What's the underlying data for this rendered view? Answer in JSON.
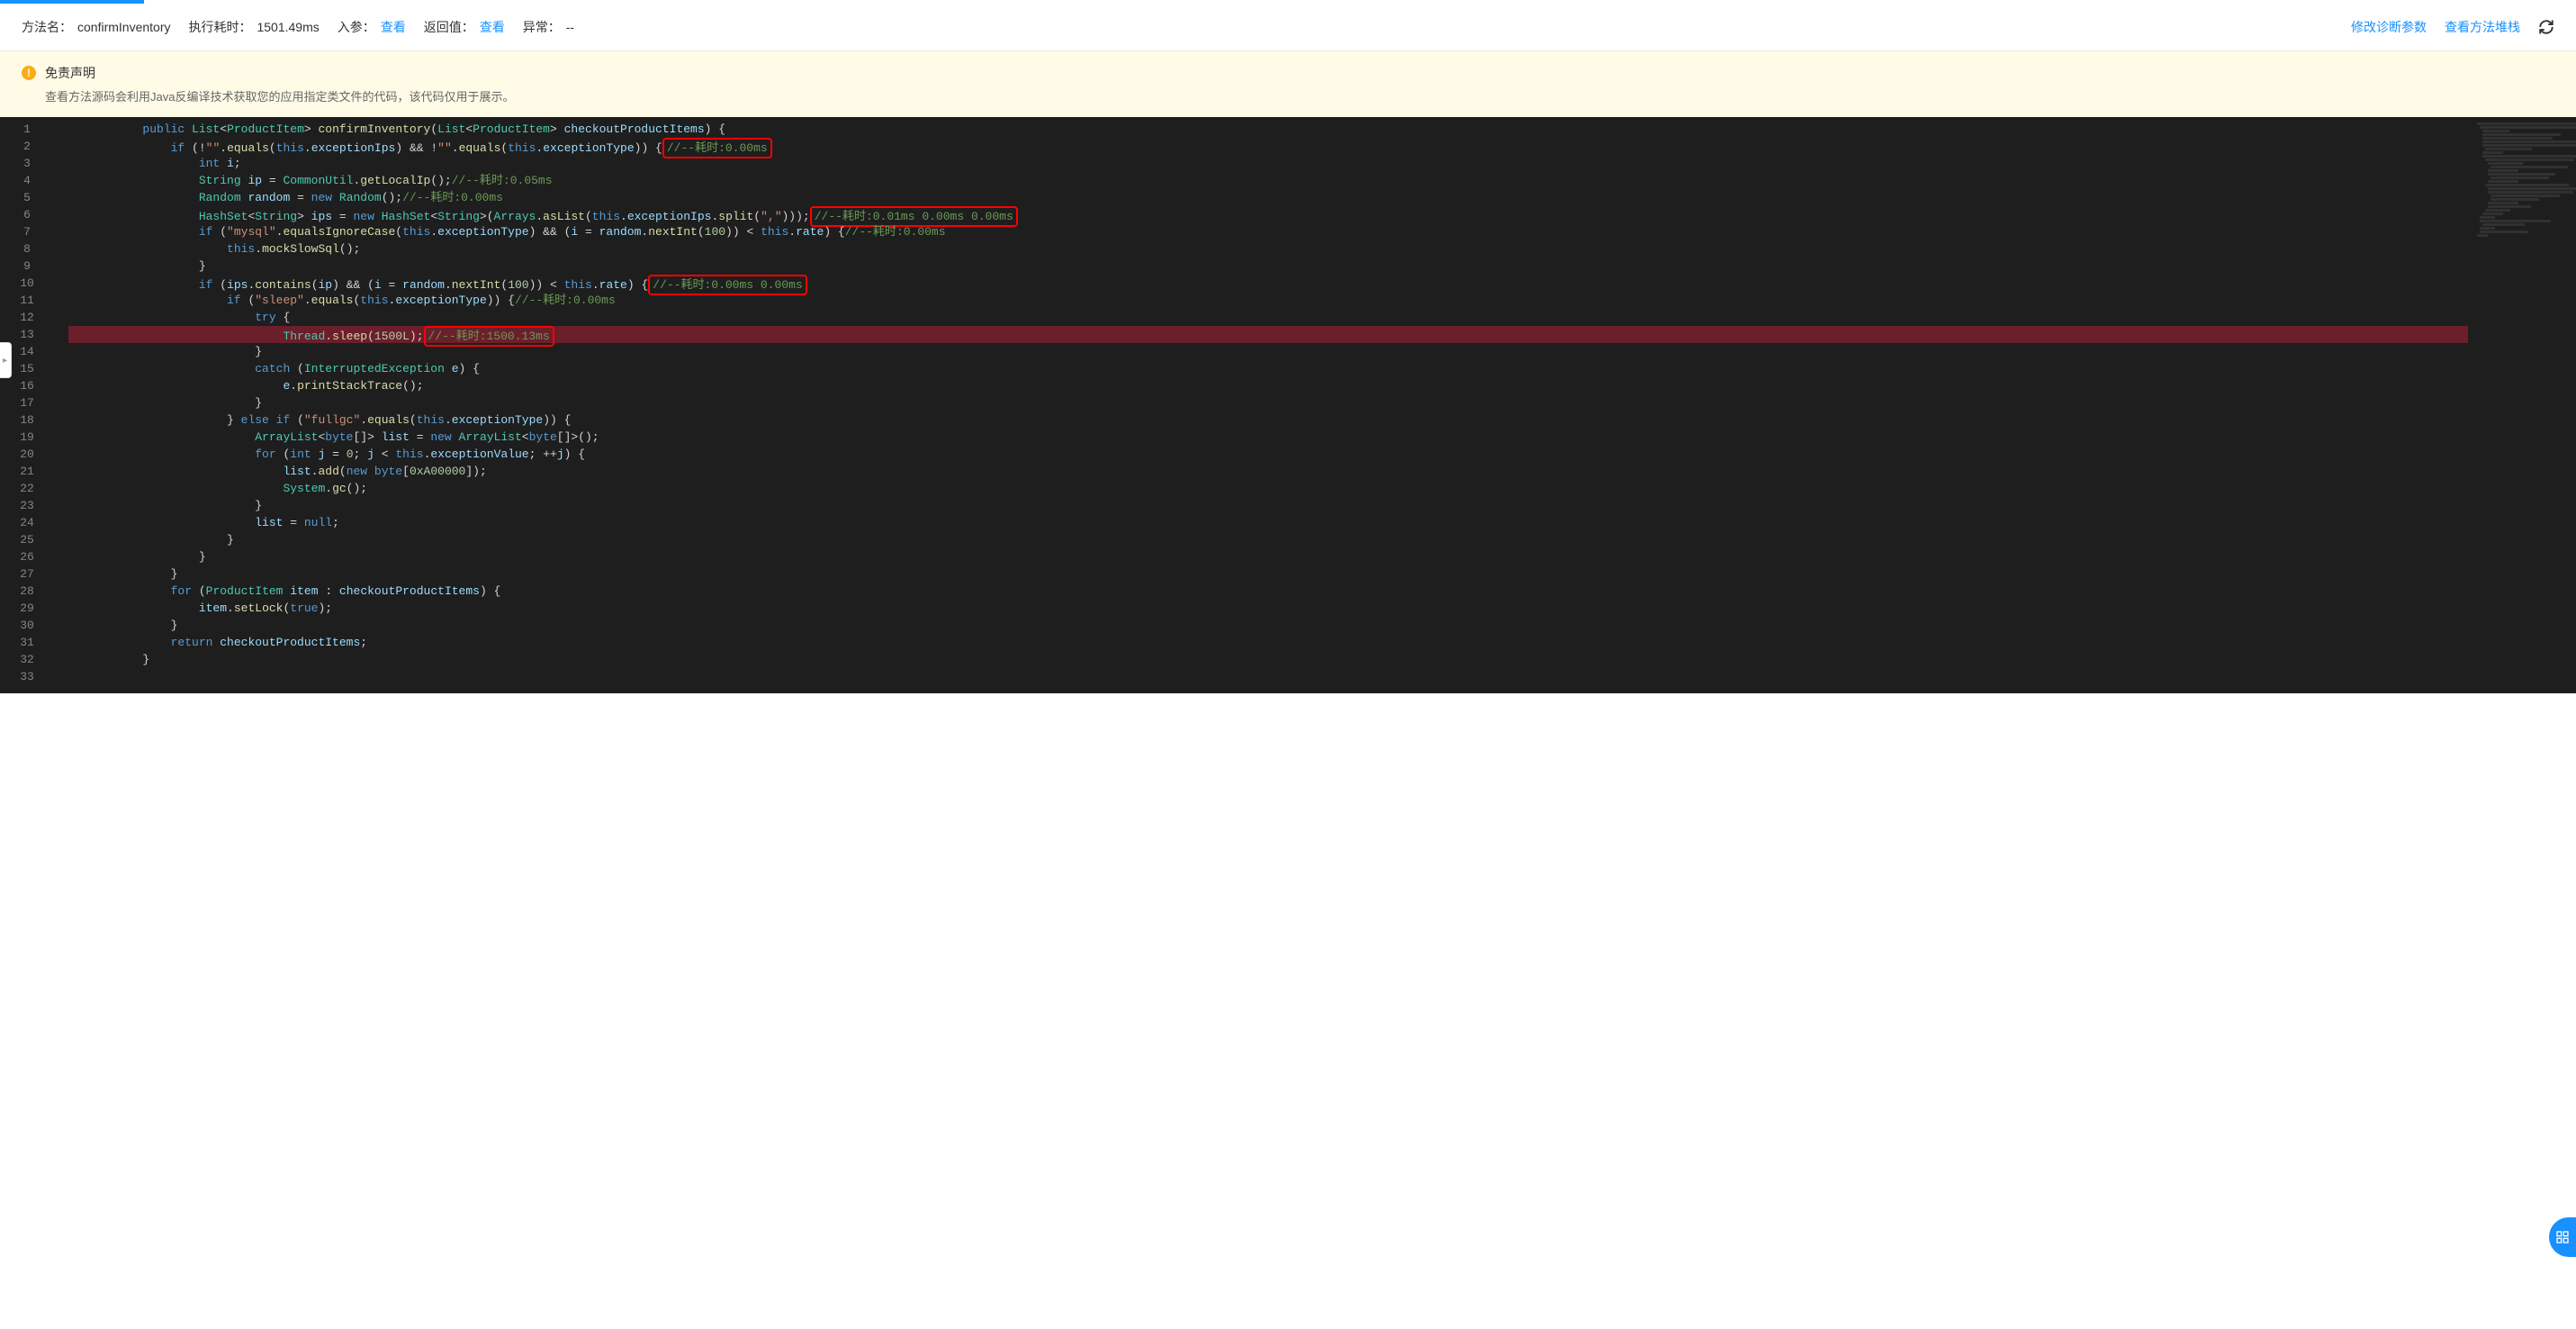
{
  "header": {
    "method_name_label": "方法名：",
    "method_name": "confirmInventory",
    "exec_time_label": "执行耗时：",
    "exec_time": "1501.49ms",
    "in_params_label": "入参：",
    "in_params_link": "查看",
    "return_value_label": "返回值：",
    "return_value_link": "查看",
    "exception_label": "异常：",
    "exception_value": "--",
    "modify_diag_params": "修改诊断参数",
    "view_method_stack": "查看方法堆栈"
  },
  "disclaimer": {
    "icon": "!",
    "title": "免责声明",
    "text": "查看方法源码会利用Java反编译技术获取您的应用指定类文件的代码，该代码仅用于展示。"
  },
  "code": {
    "lines": [
      {
        "n": 1,
        "indent": 2,
        "segs": [
          {
            "t": "public ",
            "c": "kw"
          },
          {
            "t": "List",
            "c": "type"
          },
          {
            "t": "<"
          },
          {
            "t": "ProductItem",
            "c": "type"
          },
          {
            "t": "> "
          },
          {
            "t": "confirmInventory",
            "c": "fn"
          },
          {
            "t": "("
          },
          {
            "t": "List",
            "c": "type"
          },
          {
            "t": "<"
          },
          {
            "t": "ProductItem",
            "c": "type"
          },
          {
            "t": "> "
          },
          {
            "t": "checkoutProductItems",
            "c": "prop"
          },
          {
            "t": ") {"
          }
        ]
      },
      {
        "n": 2,
        "indent": 3,
        "segs": [
          {
            "t": "if ",
            "c": "kw"
          },
          {
            "t": "(!"
          },
          {
            "t": "\"\"",
            "c": "str"
          },
          {
            "t": "."
          },
          {
            "t": "equals",
            "c": "fn"
          },
          {
            "t": "("
          },
          {
            "t": "this",
            "c": "kw"
          },
          {
            "t": "."
          },
          {
            "t": "exceptionIps",
            "c": "prop"
          },
          {
            "t": ") && !"
          },
          {
            "t": "\"\"",
            "c": "str"
          },
          {
            "t": "."
          },
          {
            "t": "equals",
            "c": "fn"
          },
          {
            "t": "("
          },
          {
            "t": "this",
            "c": "kw"
          },
          {
            "t": "."
          },
          {
            "t": "exceptionType",
            "c": "prop"
          },
          {
            "t": ")) {"
          },
          {
            "t": "//--耗时:0.00ms",
            "c": "cmt",
            "box": true
          }
        ]
      },
      {
        "n": 3,
        "indent": 4,
        "segs": [
          {
            "t": "int ",
            "c": "kw"
          },
          {
            "t": "i",
            "c": "prop"
          },
          {
            "t": ";"
          }
        ]
      },
      {
        "n": 4,
        "indent": 4,
        "segs": [
          {
            "t": "String",
            "c": "type"
          },
          {
            "t": " "
          },
          {
            "t": "ip",
            "c": "prop"
          },
          {
            "t": " = "
          },
          {
            "t": "CommonUtil",
            "c": "type"
          },
          {
            "t": "."
          },
          {
            "t": "getLocalIp",
            "c": "fn"
          },
          {
            "t": "();"
          },
          {
            "t": "//--耗时:0.05ms",
            "c": "cmt"
          }
        ]
      },
      {
        "n": 5,
        "indent": 4,
        "segs": [
          {
            "t": "Random",
            "c": "type"
          },
          {
            "t": " "
          },
          {
            "t": "random",
            "c": "prop"
          },
          {
            "t": " = "
          },
          {
            "t": "new ",
            "c": "kw"
          },
          {
            "t": "Random",
            "c": "type"
          },
          {
            "t": "();"
          },
          {
            "t": "//--耗时:0.00ms",
            "c": "cmt"
          }
        ]
      },
      {
        "n": 6,
        "indent": 4,
        "segs": [
          {
            "t": "HashSet",
            "c": "type"
          },
          {
            "t": "<"
          },
          {
            "t": "String",
            "c": "type"
          },
          {
            "t": "> "
          },
          {
            "t": "ips",
            "c": "prop"
          },
          {
            "t": " = "
          },
          {
            "t": "new ",
            "c": "kw"
          },
          {
            "t": "HashSet",
            "c": "type"
          },
          {
            "t": "<"
          },
          {
            "t": "String",
            "c": "type"
          },
          {
            "t": ">("
          },
          {
            "t": "Arrays",
            "c": "type"
          },
          {
            "t": "."
          },
          {
            "t": "asList",
            "c": "fn"
          },
          {
            "t": "("
          },
          {
            "t": "this",
            "c": "kw"
          },
          {
            "t": "."
          },
          {
            "t": "exceptionIps",
            "c": "prop"
          },
          {
            "t": "."
          },
          {
            "t": "split",
            "c": "fn"
          },
          {
            "t": "("
          },
          {
            "t": "\",\"",
            "c": "str"
          },
          {
            "t": ")));"
          },
          {
            "t": "//--耗时:0.01ms 0.00ms 0.00ms",
            "c": "cmt",
            "box": true
          }
        ]
      },
      {
        "n": 7,
        "indent": 4,
        "segs": [
          {
            "t": "if ",
            "c": "kw"
          },
          {
            "t": "("
          },
          {
            "t": "\"mysql\"",
            "c": "str"
          },
          {
            "t": "."
          },
          {
            "t": "equalsIgnoreCase",
            "c": "fn"
          },
          {
            "t": "("
          },
          {
            "t": "this",
            "c": "kw"
          },
          {
            "t": "."
          },
          {
            "t": "exceptionType",
            "c": "prop"
          },
          {
            "t": ") && ("
          },
          {
            "t": "i",
            "c": "prop"
          },
          {
            "t": " = "
          },
          {
            "t": "random",
            "c": "prop"
          },
          {
            "t": "."
          },
          {
            "t": "nextInt",
            "c": "fn"
          },
          {
            "t": "("
          },
          {
            "t": "100",
            "c": "num"
          },
          {
            "t": ")) < "
          },
          {
            "t": "this",
            "c": "kw"
          },
          {
            "t": "."
          },
          {
            "t": "rate",
            "c": "prop"
          },
          {
            "t": ") {"
          },
          {
            "t": "//--耗时:0.00ms",
            "c": "cmt"
          }
        ]
      },
      {
        "n": 8,
        "indent": 5,
        "segs": [
          {
            "t": "this",
            "c": "kw"
          },
          {
            "t": "."
          },
          {
            "t": "mockSlowSql",
            "c": "fn"
          },
          {
            "t": "();"
          }
        ]
      },
      {
        "n": 9,
        "indent": 4,
        "segs": [
          {
            "t": "}"
          }
        ]
      },
      {
        "n": 10,
        "indent": 4,
        "segs": [
          {
            "t": "if ",
            "c": "kw"
          },
          {
            "t": "("
          },
          {
            "t": "ips",
            "c": "prop"
          },
          {
            "t": "."
          },
          {
            "t": "contains",
            "c": "fn"
          },
          {
            "t": "("
          },
          {
            "t": "ip",
            "c": "prop"
          },
          {
            "t": ") && ("
          },
          {
            "t": "i",
            "c": "prop"
          },
          {
            "t": " = "
          },
          {
            "t": "random",
            "c": "prop"
          },
          {
            "t": "."
          },
          {
            "t": "nextInt",
            "c": "fn"
          },
          {
            "t": "("
          },
          {
            "t": "100",
            "c": "num"
          },
          {
            "t": ")) < "
          },
          {
            "t": "this",
            "c": "kw"
          },
          {
            "t": "."
          },
          {
            "t": "rate",
            "c": "prop"
          },
          {
            "t": ") {"
          },
          {
            "t": "//--耗时:0.00ms 0.00ms",
            "c": "cmt",
            "box": true
          }
        ]
      },
      {
        "n": 11,
        "indent": 5,
        "segs": [
          {
            "t": "if ",
            "c": "kw"
          },
          {
            "t": "("
          },
          {
            "t": "\"sleep\"",
            "c": "str"
          },
          {
            "t": "."
          },
          {
            "t": "equals",
            "c": "fn"
          },
          {
            "t": "("
          },
          {
            "t": "this",
            "c": "kw"
          },
          {
            "t": "."
          },
          {
            "t": "exceptionType",
            "c": "prop"
          },
          {
            "t": ")) {"
          },
          {
            "t": "//--耗时:0.00ms",
            "c": "cmt"
          }
        ]
      },
      {
        "n": 12,
        "indent": 6,
        "segs": [
          {
            "t": "try ",
            "c": "kw"
          },
          {
            "t": "{"
          }
        ]
      },
      {
        "n": 13,
        "indent": 7,
        "highlighted": true,
        "segs": [
          {
            "t": "Thread",
            "c": "type"
          },
          {
            "t": "."
          },
          {
            "t": "sleep",
            "c": "fn"
          },
          {
            "t": "("
          },
          {
            "t": "1500L",
            "c": "num"
          },
          {
            "t": ");"
          },
          {
            "t": "//--耗时:1500.13ms",
            "c": "cmt",
            "box": true
          }
        ]
      },
      {
        "n": 14,
        "indent": 6,
        "segs": [
          {
            "t": "}"
          }
        ]
      },
      {
        "n": 15,
        "indent": 6,
        "segs": [
          {
            "t": "catch ",
            "c": "kw"
          },
          {
            "t": "("
          },
          {
            "t": "InterruptedException",
            "c": "type"
          },
          {
            "t": " "
          },
          {
            "t": "e",
            "c": "prop"
          },
          {
            "t": ") {"
          }
        ]
      },
      {
        "n": 16,
        "indent": 7,
        "segs": [
          {
            "t": "e",
            "c": "prop"
          },
          {
            "t": "."
          },
          {
            "t": "printStackTrace",
            "c": "fn"
          },
          {
            "t": "();"
          }
        ]
      },
      {
        "n": 17,
        "indent": 6,
        "segs": [
          {
            "t": "}"
          }
        ]
      },
      {
        "n": 18,
        "indent": 5,
        "segs": [
          {
            "t": "} "
          },
          {
            "t": "else if ",
            "c": "kw"
          },
          {
            "t": "("
          },
          {
            "t": "\"fullgc\"",
            "c": "str"
          },
          {
            "t": "."
          },
          {
            "t": "equals",
            "c": "fn"
          },
          {
            "t": "("
          },
          {
            "t": "this",
            "c": "kw"
          },
          {
            "t": "."
          },
          {
            "t": "exceptionType",
            "c": "prop"
          },
          {
            "t": ")) {"
          }
        ]
      },
      {
        "n": 19,
        "indent": 6,
        "segs": [
          {
            "t": "ArrayList",
            "c": "type"
          },
          {
            "t": "<"
          },
          {
            "t": "byte",
            "c": "kw"
          },
          {
            "t": "[]> "
          },
          {
            "t": "list",
            "c": "prop"
          },
          {
            "t": " = "
          },
          {
            "t": "new ",
            "c": "kw"
          },
          {
            "t": "ArrayList",
            "c": "type"
          },
          {
            "t": "<"
          },
          {
            "t": "byte",
            "c": "kw"
          },
          {
            "t": "[]>();"
          }
        ]
      },
      {
        "n": 20,
        "indent": 6,
        "segs": [
          {
            "t": "for ",
            "c": "kw"
          },
          {
            "t": "("
          },
          {
            "t": "int ",
            "c": "kw"
          },
          {
            "t": "j",
            "c": "prop"
          },
          {
            "t": " = "
          },
          {
            "t": "0",
            "c": "num"
          },
          {
            "t": "; "
          },
          {
            "t": "j",
            "c": "prop"
          },
          {
            "t": " < "
          },
          {
            "t": "this",
            "c": "kw"
          },
          {
            "t": "."
          },
          {
            "t": "exceptionValue",
            "c": "prop"
          },
          {
            "t": "; ++"
          },
          {
            "t": "j",
            "c": "prop"
          },
          {
            "t": ") {"
          }
        ]
      },
      {
        "n": 21,
        "indent": 7,
        "segs": [
          {
            "t": "list",
            "c": "prop"
          },
          {
            "t": "."
          },
          {
            "t": "add",
            "c": "fn"
          },
          {
            "t": "("
          },
          {
            "t": "new ",
            "c": "kw"
          },
          {
            "t": "byte",
            "c": "kw"
          },
          {
            "t": "["
          },
          {
            "t": "0xA00000",
            "c": "num"
          },
          {
            "t": "]);"
          }
        ]
      },
      {
        "n": 22,
        "indent": 7,
        "segs": [
          {
            "t": "System",
            "c": "type"
          },
          {
            "t": "."
          },
          {
            "t": "gc",
            "c": "fn"
          },
          {
            "t": "();"
          }
        ]
      },
      {
        "n": 23,
        "indent": 6,
        "segs": [
          {
            "t": "}"
          }
        ]
      },
      {
        "n": 24,
        "indent": 6,
        "segs": [
          {
            "t": "list",
            "c": "prop"
          },
          {
            "t": " = "
          },
          {
            "t": "null",
            "c": "kw"
          },
          {
            "t": ";"
          }
        ]
      },
      {
        "n": 25,
        "indent": 5,
        "segs": [
          {
            "t": "}"
          }
        ]
      },
      {
        "n": 26,
        "indent": 4,
        "segs": [
          {
            "t": "}"
          }
        ]
      },
      {
        "n": 27,
        "indent": 3,
        "segs": [
          {
            "t": "}"
          }
        ]
      },
      {
        "n": 28,
        "indent": 3,
        "segs": [
          {
            "t": "for ",
            "c": "kw"
          },
          {
            "t": "("
          },
          {
            "t": "ProductItem",
            "c": "type"
          },
          {
            "t": " "
          },
          {
            "t": "item",
            "c": "prop"
          },
          {
            "t": " : "
          },
          {
            "t": "checkoutProductItems",
            "c": "prop"
          },
          {
            "t": ") {"
          }
        ]
      },
      {
        "n": 29,
        "indent": 4,
        "segs": [
          {
            "t": "item",
            "c": "prop"
          },
          {
            "t": "."
          },
          {
            "t": "setLock",
            "c": "fn"
          },
          {
            "t": "("
          },
          {
            "t": "true",
            "c": "kw"
          },
          {
            "t": ");"
          }
        ]
      },
      {
        "n": 30,
        "indent": 3,
        "segs": [
          {
            "t": "}"
          }
        ]
      },
      {
        "n": 31,
        "indent": 3,
        "segs": [
          {
            "t": "return ",
            "c": "kw"
          },
          {
            "t": "checkoutProductItems",
            "c": "prop"
          },
          {
            "t": ";"
          }
        ]
      },
      {
        "n": 32,
        "indent": 2,
        "segs": [
          {
            "t": "}"
          }
        ]
      },
      {
        "n": 33,
        "indent": 0,
        "segs": []
      }
    ]
  }
}
